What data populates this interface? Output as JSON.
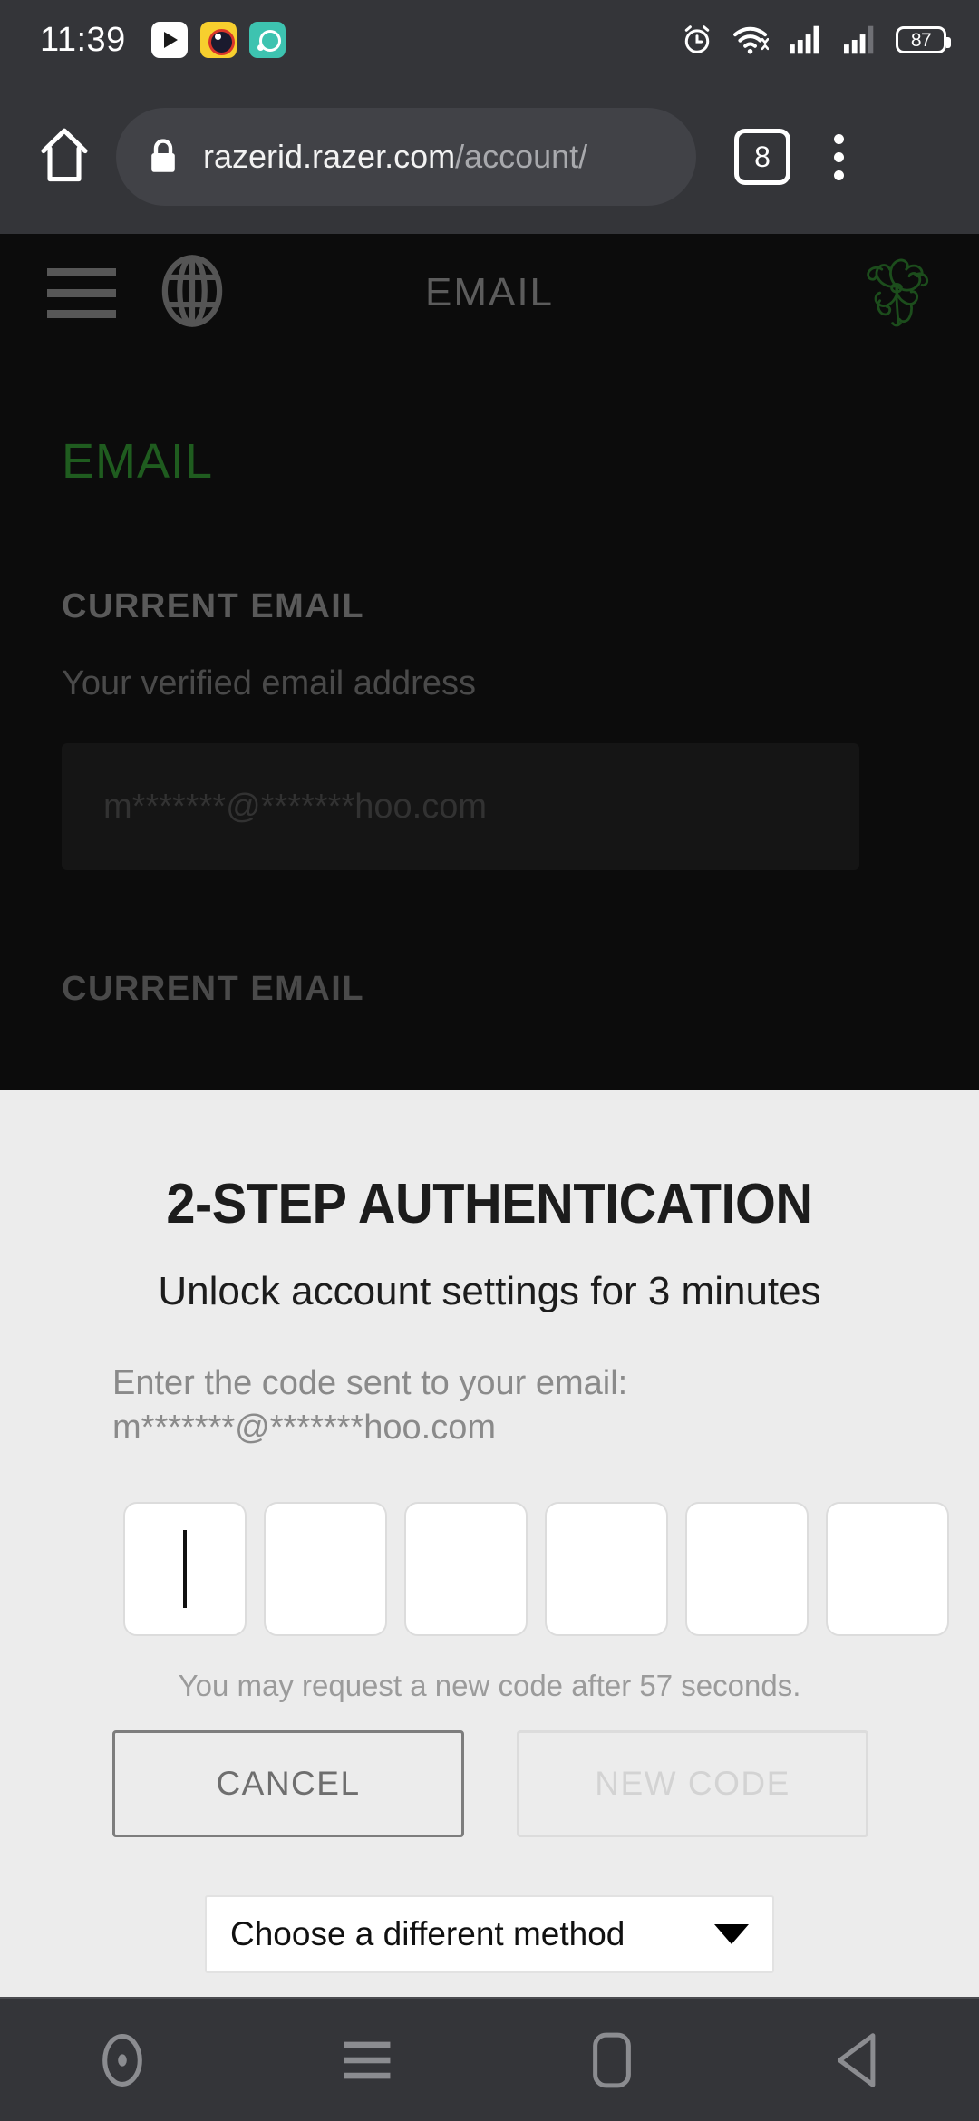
{
  "status_bar": {
    "clock": "11:39",
    "notification_icons": [
      "youtube-icon",
      "camera-eye-icon",
      "teal-app-icon"
    ],
    "system_icons": [
      "alarm-icon",
      "wifi-icon",
      "signal-sim1-icon",
      "signal-sim2-icon"
    ],
    "battery_percent": "87"
  },
  "browser": {
    "home_icon": "home-icon",
    "lock_icon": "lock-icon",
    "url_domain": "razerid.razer.com",
    "url_path": "/account/",
    "tab_count": "8",
    "menu_icon": "overflow-menu-icon"
  },
  "page": {
    "menu_icon": "hamburger-menu-icon",
    "language_icon": "globe-icon",
    "header_title": "EMAIL",
    "brand_logo": "razer-logo-icon",
    "title": "EMAIL",
    "section_label": "CURRENT EMAIL",
    "section_sub": "Your verified email address",
    "email_value": "m*******@*******hoo.com",
    "section_label_2": "CURRENT EMAIL"
  },
  "modal": {
    "title": "2-STEP AUTHENTICATION",
    "subtitle": "Unlock account settings for 3 minutes",
    "instruction_line1": "Enter the code sent to your email:",
    "instruction_line2": "m*******@*******hoo.com",
    "otp_length": 6,
    "otp_values": [
      "",
      "",
      "",
      "",
      "",
      ""
    ],
    "otp_focused_index": 0,
    "resend_hint": "You may request a new code after 57 seconds.",
    "cancel_label": "CANCEL",
    "new_code_label": "NEW CODE",
    "new_code_disabled": true,
    "method_select_label": "Choose a different method",
    "method_select_arrow": "chevron-down-icon"
  },
  "nav_bar": {
    "items": [
      "assistant-dot-icon",
      "recents-menu-icon",
      "home-square-icon",
      "back-triangle-icon"
    ]
  },
  "colors": {
    "accent_green": "#1f5c1f",
    "modal_bg": "#ececec",
    "chrome_bg": "#343539",
    "page_bg": "#0c0c0c"
  }
}
